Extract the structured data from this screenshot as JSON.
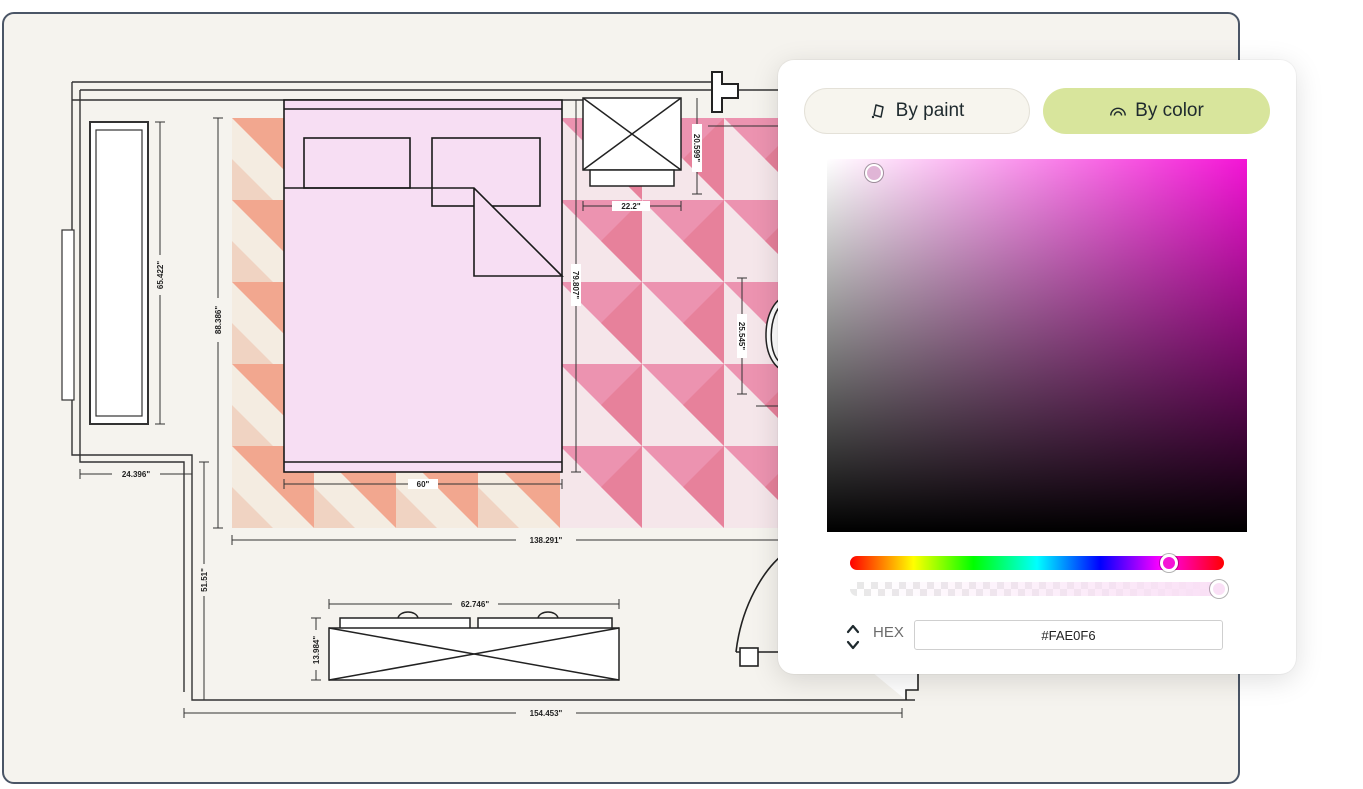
{
  "picker": {
    "tabs": {
      "by_paint": {
        "label": "By paint",
        "icon": "paint-can-icon"
      },
      "by_color": {
        "label": "By color",
        "icon": "rainbow-icon",
        "active": true
      }
    },
    "hex_label": "HEX",
    "hex_value": "#FAE0F6",
    "hue_color": "#F414D6",
    "alpha": 1.0
  },
  "floorplan": {
    "dimensions": {
      "wall_left_width": "24.396\"",
      "window_length": "65.422\"",
      "rug_height": "88.386\"",
      "rug_width": "138.291\"",
      "bed_width": "60\"",
      "bed_length": "79.807\"",
      "nightstand_width": "22.2\"",
      "nightstand_depth": "20.599\"",
      "chair_depth": "25.545\"",
      "wall_lower_left": "51.51\"",
      "dresser_width": "62.746\"",
      "dresser_depth": "13.984\"",
      "room_width": "154.453\""
    },
    "bed_color": "#F7DEF3"
  }
}
